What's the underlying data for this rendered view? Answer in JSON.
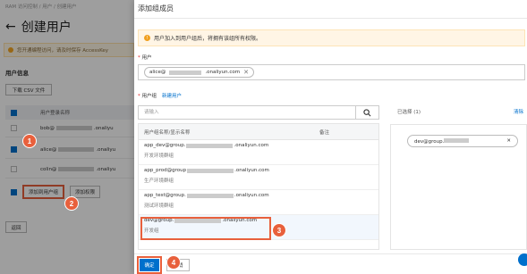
{
  "background": {
    "breadcrumb": "RAM 访问控制 / 用户 / 创建用户",
    "page_title": "创建用户",
    "notice": "您开通编程访问，请及时保存 AccessKey",
    "section_title": "用户信息",
    "download_csv": "下载 CSV 文件",
    "table_header": "用户登录名称",
    "rows": [
      {
        "prefix": "bob@",
        "suffix": ".onaliyu"
      },
      {
        "prefix": "alice@",
        "suffix": ".onaliyu"
      },
      {
        "prefix": "colin@",
        "suffix": ".onaliyu"
      }
    ],
    "add_to_group_button": "添加到用户组",
    "add_permission_button": "添加权限",
    "return_button": "返回"
  },
  "drawer": {
    "title": "添加组成员",
    "tip": "用户加入到用户组后，将拥有该组所有权限。",
    "user_label": "用户",
    "user_tag_prefix": "alice@",
    "user_tag_suffix": ".onaliyun.com",
    "group_label": "用户组",
    "new_group_link": "新建用户",
    "search_placeholder": "请输入",
    "list_header_name": "用户组名称/显示名称",
    "list_header_note": "备注",
    "groups": [
      {
        "prefix": "app_dev@group.",
        "suffix": ".onaliyun.com",
        "desc": "开发环境群组"
      },
      {
        "prefix": "app_prod@group",
        "suffix": ".onaliyun.com",
        "desc": "生产环境群组"
      },
      {
        "prefix": "app_test@group.",
        "suffix": ".onaliyun.com",
        "desc": "测试环境群组"
      },
      {
        "prefix": "dev@group.",
        "suffix": ".onaliyun.com",
        "desc": "开发组"
      }
    ],
    "selected_label": "已选择 (1)",
    "clear_link": "清除",
    "selected_chip_prefix": "dev@group.",
    "ok_button": "确定",
    "cancel_button": "取消"
  },
  "annotations": [
    "1",
    "2",
    "3",
    "4"
  ],
  "colors": {
    "accent": "#0070cc",
    "highlight": "#e8603c"
  }
}
